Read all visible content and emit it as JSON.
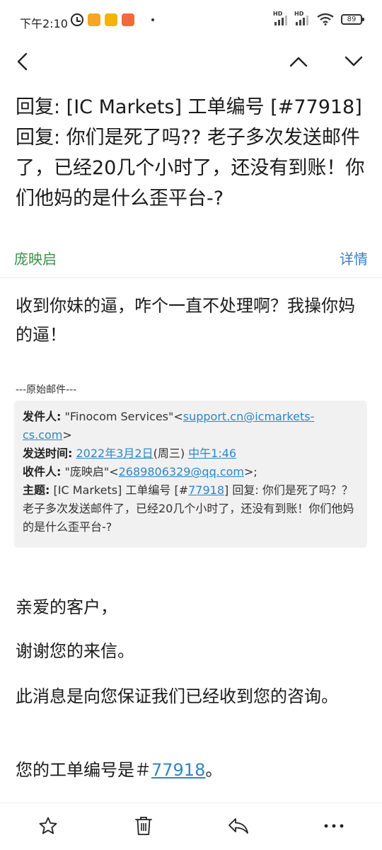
{
  "status_bar": {
    "time": "下午2:10",
    "battery": "89",
    "network_label_1": "HD",
    "network_label_2": "HD"
  },
  "email": {
    "subject": "回复: [IC Markets] 工单编号 [#77918] 回复: 你们是死了吗?? 老子多次发送邮件了，已经20几个小时了，还没有到账！你们他妈的是什么歪平台-?",
    "sender": "庞映启",
    "details_label": "详情",
    "body": "收到你妹的逼，咋个一直不处理啊？我操你妈的逼！",
    "original_label": "---原始邮件---",
    "quote": {
      "from_label": "发件人:",
      "from_name": " \"Finocom Services\"<",
      "from_email": "support.cn@icmarkets-cs.com",
      "from_close": ">",
      "sent_label": "发送时间:",
      "sent_date": "2022年3月2日",
      "sent_weekday": "(周三) ",
      "sent_time": "中午1:46",
      "to_label": "收件人:",
      "to_name": " \"庞映启\"<",
      "to_email": "2689806329@qq.com",
      "to_close": ">;",
      "subject_label": "主题:",
      "subject_pre": " [IC Markets] 工单编号 [#",
      "subject_ticket": "77918",
      "subject_post": "] 回复: 你们是死了吗？？ 老子多次发送邮件了，已经20几个小时了，还没有到账！你们他妈的是什么歪平台-?"
    },
    "greeting": "亲爱的客户，",
    "thanks": "谢谢您的来信。",
    "confirm": "此消息是向您保证我们已经收到您的咨询。",
    "ticket_pre": "您的工单编号是＃",
    "ticket_number": "77918",
    "ticket_post": "。"
  },
  "icons": {
    "back": "back-arrow-icon",
    "prev": "chevron-up-icon",
    "next": "chevron-down-icon",
    "star": "star-icon",
    "delete": "trash-icon",
    "reply": "reply-icon",
    "more": "more-icon"
  },
  "colors": {
    "sender": "#3a8f47",
    "link": "#2f86c6",
    "details": "#3b7fc4",
    "quote_bg": "#f1f1f1"
  }
}
